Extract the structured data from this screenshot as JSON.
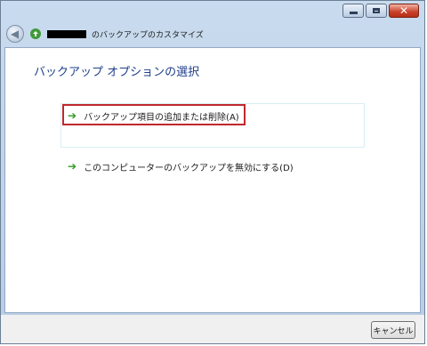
{
  "window": {
    "controls": {
      "minimize": "–",
      "maximize": "□",
      "close": "✕"
    }
  },
  "nav": {
    "back_icon": "back-arrow-icon",
    "app_icon": "backup-app-icon",
    "title_suffix": "のバックアップのカスタマイズ"
  },
  "main": {
    "heading": "バックアップ オプションの選択",
    "options": [
      {
        "label": "バックアップ項目の追加または削除(A)",
        "icon": "green-arrow-icon",
        "highlighted": true
      },
      {
        "label": "このコンピューターのバックアップを無効にする(D)",
        "icon": "green-arrow-icon",
        "highlighted": false
      }
    ]
  },
  "footer": {
    "cancel_label": "キャンセル"
  },
  "colors": {
    "heading": "#1e3f8a",
    "highlight_border": "#c0272d",
    "arrow": "#2e9a1e"
  }
}
